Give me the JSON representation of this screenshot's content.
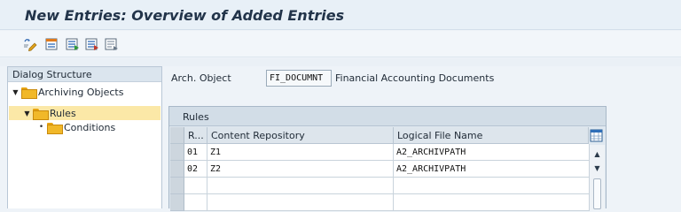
{
  "window": {
    "title": "New Entries: Overview of Added Entries"
  },
  "toolbar": {
    "buttons": [
      {
        "name": "display-change-icon"
      },
      {
        "name": "select-all-icon"
      },
      {
        "name": "select-block-icon"
      },
      {
        "name": "deselect-all-icon"
      },
      {
        "name": "copy-entry-icon"
      }
    ]
  },
  "dialog_structure": {
    "header": "Dialog Structure",
    "nodes": [
      {
        "label": "Archiving Objects",
        "expanded": true,
        "level": 0
      },
      {
        "label": "Rules",
        "expanded": true,
        "level": 1,
        "selected": true
      },
      {
        "label": "Conditions",
        "expanded": false,
        "level": 2
      }
    ]
  },
  "form": {
    "arch_object_label": "Arch. Object",
    "arch_object_value": "FI_DOCUMNT",
    "arch_object_description": "Financial Accounting Documents"
  },
  "rules_table": {
    "title": "Rules",
    "columns": [
      "R...",
      "Content Repository",
      "Logical File Name"
    ],
    "rows": [
      [
        "01",
        "Z1",
        "A2_ARCHIVPATH"
      ],
      [
        "02",
        "Z2",
        "A2_ARCHIVPATH"
      ],
      [
        "",
        "",
        ""
      ],
      [
        "",
        "",
        ""
      ]
    ]
  },
  "colors": {
    "title_bar": "#e8f0f7",
    "selection": "#fbe8a7",
    "folder": "#f1b829",
    "grid_header": "#dde5ec"
  }
}
